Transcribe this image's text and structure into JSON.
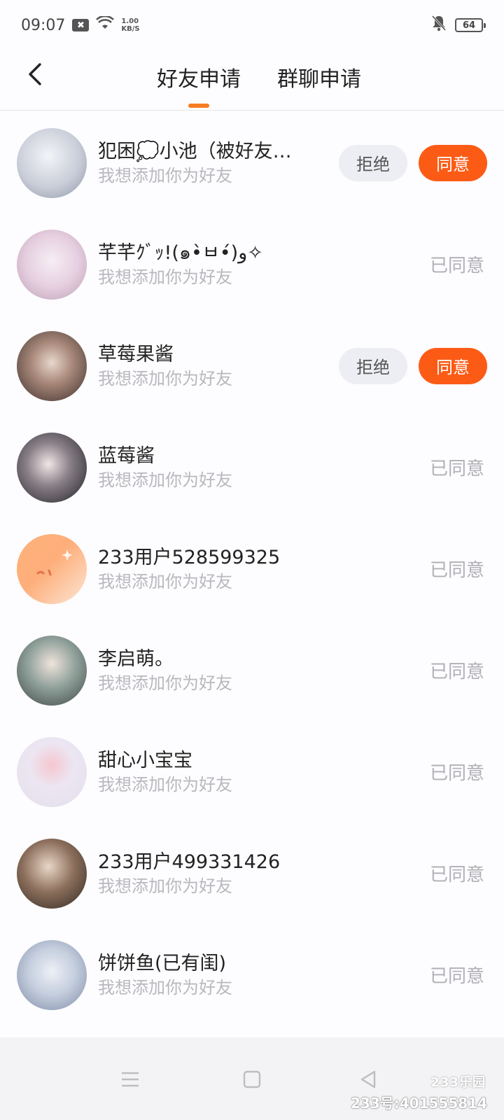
{
  "status_bar": {
    "time": "09:07",
    "speed_value": "1.00",
    "speed_unit": "KB/S",
    "battery": "64"
  },
  "header": {
    "tabs": [
      {
        "label": "好友申请",
        "active": true
      },
      {
        "label": "群聊申请",
        "active": false
      }
    ]
  },
  "requests": [
    {
      "name": "犯困💭小池（被好友…",
      "message": "我想添加你为好友",
      "state": "pending",
      "reject_label": "拒绝",
      "accept_label": "同意",
      "avatar_color": "#c9cdd8"
    },
    {
      "name": "芊芊ｸﾞｯ!(๑•̀ㅂ•́)و✧",
      "message": "我想添加你为好友",
      "state": "accepted",
      "status_label": "已同意",
      "avatar_color": "#e6cfe0"
    },
    {
      "name": "草莓果酱",
      "message": "我想添加你为好友",
      "state": "pending",
      "reject_label": "拒绝",
      "accept_label": "同意",
      "avatar_color": "#6b5a52"
    },
    {
      "name": "蓝莓酱",
      "message": "我想添加你为好友",
      "state": "accepted",
      "status_label": "已同意",
      "avatar_color": "#3a3a40"
    },
    {
      "name": "233用户528599325",
      "message": "我想添加你为好友",
      "state": "accepted",
      "status_label": "已同意",
      "avatar_color": "#fdae7a"
    },
    {
      "name": "李启萌。",
      "message": "我想添加你为好友",
      "state": "accepted",
      "status_label": "已同意",
      "avatar_color": "#7d8a84"
    },
    {
      "name": "甜心小宝宝",
      "message": "我想添加你为好友",
      "state": "accepted",
      "status_label": "已同意",
      "avatar_color": "#e7e2ee"
    },
    {
      "name": "233用户499331426",
      "message": "我想添加你为好友",
      "state": "accepted",
      "status_label": "已同意",
      "avatar_color": "#5c4a3e"
    },
    {
      "name": "饼饼鱼(已有闺)",
      "message": "我想添加你为好友",
      "state": "accepted",
      "status_label": "已同意",
      "avatar_color": "#c4cede"
    }
  ],
  "watermark": {
    "logo": "233乐园",
    "id": "233号:401555814"
  },
  "colors": {
    "accent": "#f57c20",
    "accept_button": "#fc5b16",
    "reject_button": "#eceef3",
    "muted_text": "#b8b8be"
  }
}
